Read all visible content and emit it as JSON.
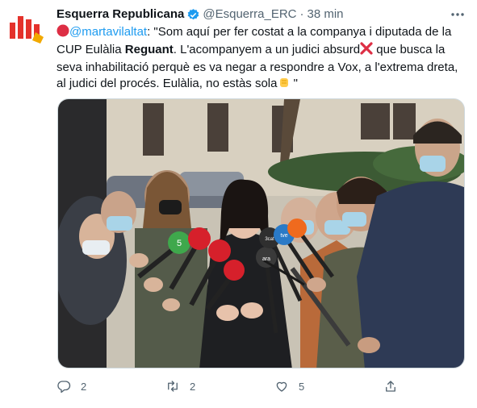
{
  "tweet": {
    "author_name": "Esquerra Republicana",
    "handle": "@Esquerra_ERC",
    "separator": "·",
    "time": "38 min",
    "text": {
      "mention": "@martavilaltat",
      "part1": ": \"Som aquí per fer costat a la companya i diputada de la CUP Eulàlia ",
      "bold": "Reguant",
      "part2": ". L'acompanyem a un judici absurd",
      "part3": " que busca la seva inhabilitació perquè es va negar a respondre a Vox, a l'extrema dreta, al judici del procés. Eulàlia, no estàs sola",
      "part4": " \""
    },
    "media": {
      "mic_labels": [
        "5",
        "ara",
        "tve",
        "3cat"
      ]
    },
    "actions": {
      "replies": "2",
      "retweets": "2",
      "likes": "5"
    }
  },
  "colors": {
    "accent": "#1d9bf0",
    "muted": "#536471",
    "erc_orange": "#f2a900",
    "erc_red": "#e4322b"
  },
  "icons": [
    "erc-logo-icon",
    "verified-badge-icon",
    "more-options-icon",
    "red-circle-emoji-icon",
    "cross-mark-emoji-icon",
    "raised-fist-emoji-icon",
    "reply-icon",
    "retweet-icon",
    "like-icon",
    "share-icon"
  ]
}
